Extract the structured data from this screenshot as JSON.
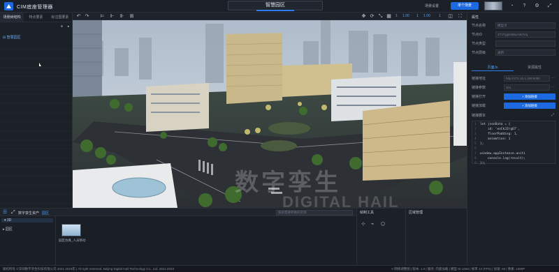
{
  "app": {
    "title": "CIM底座管理器"
  },
  "scene_tab": {
    "label": "智慧园区"
  },
  "top_right": {
    "scene_setting": "场景设置",
    "button": "单个场景",
    "icons": [
      "bell-icon",
      "help-icon",
      "settings-icon",
      "expand-icon"
    ]
  },
  "left_panel": {
    "tabs": [
      "场景树结构",
      "特点要素",
      "标注图要素"
    ],
    "tree": [
      {
        "label": "智慧园区"
      }
    ]
  },
  "viewport_toolbar": {
    "values": [
      "1",
      "1.00",
      "1",
      "1.00",
      "1"
    ]
  },
  "viewport": {
    "watermark_line1": "数字孪生",
    "watermark_line2": "DIGITAL HAIL"
  },
  "right_panel": {
    "title": "属性",
    "props": [
      {
        "label": "节点名称",
        "value": "模型点"
      },
      {
        "label": "节点ID",
        "value": "ZTI7QgEI8BuAI6OVq"
      },
      {
        "label": "节点类型",
        "value": ""
      },
      {
        "label": "节点层级",
        "value": "通用"
      }
    ],
    "tabs": [
      "页面Js",
      "资源属性"
    ],
    "page_rows": [
      {
        "label": "链接地址",
        "value": "http://172.16.1.199:8080"
      },
      {
        "label": "链接参数",
        "value": "101"
      }
    ],
    "button_rows": [
      {
        "label": "链接打开",
        "button": "+ 添加链接"
      },
      {
        "label": "链接加载",
        "button": "+ 添加链接"
      }
    ],
    "code_label": "链接脚本",
    "code_lines": [
      "let jsonData = {",
      "    id: 'eoCkJZrg67',",
      "    floorPadding: 1,",
      "    animation: 1",
      "};",
      "",
      "window.appInstance.uniti",
      "    console.log(result);",
      "});"
    ]
  },
  "bottom_panel": {
    "breadcrumb": "数字孪生资产",
    "breadcrumb_sub": "园区",
    "search_placeholder": "搜索需要转换的资源",
    "tree": [
      {
        "label": "3D"
      },
      {
        "label": "园区"
      }
    ],
    "asset_label": "园区仿真_人员移动",
    "panel2_title": "绘制工具",
    "panel3_title": "区域管理"
  },
  "status_bar": {
    "left": "版权所有 ©深圳数字孪生科技有限公司 2021-2023年 | All right reserved. Beijing Digital Hail Technology Co., Ltd. 2021-2023",
    "right": "V 网络调整图 | 版本: 1.0 | 服务: 内部加载 | 模型 ID 1060 | 帧率 12 (FPS) | 加速: 60 | 像素: 1080P"
  }
}
